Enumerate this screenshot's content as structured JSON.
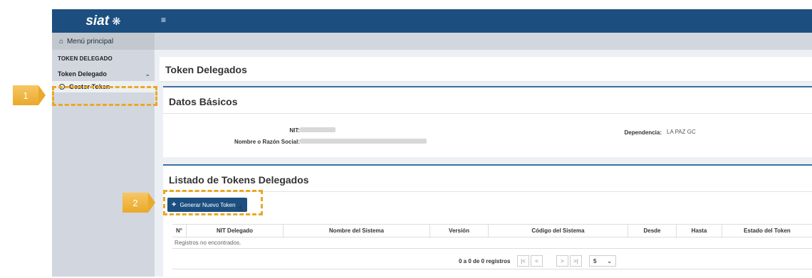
{
  "app": {
    "logo_text": "siat",
    "logo_mark": "❋",
    "menu_icon": "≡"
  },
  "sidebar": {
    "main_menu_label": "Menú principal",
    "section_header": "TOKEN DELEGADO",
    "group_label": "Token Delegado",
    "active_item": "Gestor Token"
  },
  "page": {
    "title": "Token Delegados"
  },
  "datos": {
    "title": "Datos Básicos",
    "nit_label": "NIT:",
    "razon_label": "Nombre o Razón Social:",
    "dependencia_label": "Dependencia:",
    "dependencia_value": "LA PAZ GC"
  },
  "listado": {
    "title": "Listado de Tokens Delegados",
    "generate_button": "Generar Nuevo Token",
    "columns": [
      "N°",
      "NIT Delegado",
      "Nombre del Sistema",
      "Versión",
      "Código del Sistema",
      "Desde",
      "Hasta",
      "Estado del Token"
    ],
    "empty_message": "Registros no encontrados.",
    "pagination_info": "0 a 0 de 0 registros",
    "page_size": "5"
  },
  "callouts": [
    "1",
    "2"
  ]
}
